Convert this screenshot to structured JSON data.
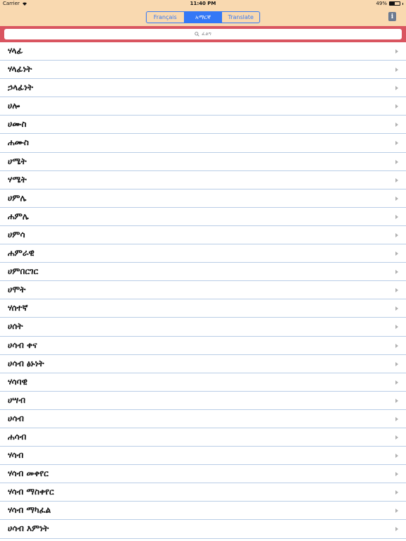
{
  "status_bar": {
    "carrier": "Carrier",
    "time": "11:40 PM",
    "battery": "49%",
    "battery_level": 0.49
  },
  "nav": {
    "segments": [
      {
        "label": "Français",
        "active": false
      },
      {
        "label": "አማርኛ",
        "active": true
      },
      {
        "label": "Translate",
        "active": false
      }
    ],
    "info_label": "i"
  },
  "search": {
    "placeholder": "ፈልግ"
  },
  "colors": {
    "nav_bg": "#f9d9b0",
    "search_bar_bg": "#d95560",
    "accent": "#3478f6",
    "separator": "#b9cde6"
  },
  "list": {
    "items": [
      "ሃላፊ",
      "ሃላፊነት",
      "ኃላፊነት",
      "ሀሎ",
      "ሀሙስ",
      "ሐሙስ",
      "ሀሜት",
      "ሃሜት",
      "ሀምሌ",
      "ሐምሌ",
      "ሀምሳ",
      "ሐምራዊ",
      "ሀምበርገር",
      "ሀሞት",
      "ሃሰተኛ",
      "ሀሰት",
      "ሀሳብ ቀና",
      "ሀሳብ ፅኑነት",
      "ሃሳባዊ",
      "ሀሣብ",
      "ሀሳብ",
      "ሐሳብ",
      "ሃሳብ",
      "ሃሳብ መቀየር",
      "ሃሳብ ማስቀየር",
      "ሃሳብ ማካፈል",
      "ሀሳብ እምነት"
    ]
  }
}
